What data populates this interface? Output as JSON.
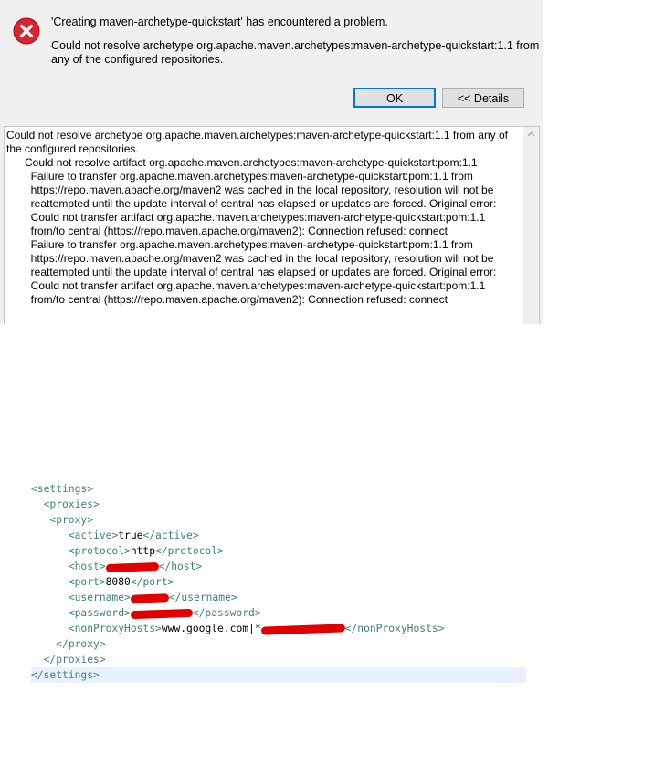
{
  "dialog": {
    "title": "'Creating maven-archetype-quickstart' has encountered a problem.",
    "message": "Could not resolve archetype org.apache.maven.archetypes:maven-archetype-quickstart:1.1 from any of the configured repositories.",
    "ok_label": "OK",
    "details_label": "<< Details",
    "details_text": "Could not resolve archetype org.apache.maven.archetypes:maven-archetype-quickstart:1.1 from any of the configured repositories.\n      Could not resolve artifact org.apache.maven.archetypes:maven-archetype-quickstart:pom:1.1\n        Failure to transfer org.apache.maven.archetypes:maven-archetype-quickstart:pom:1.1 from\n        https://repo.maven.apache.org/maven2 was cached in the local repository, resolution will not be\n        reattempted until the update interval of central has elapsed or updates are forced. Original error:\n        Could not transfer artifact org.apache.maven.archetypes:maven-archetype-quickstart:pom:1.1\n        from/to central (https://repo.maven.apache.org/maven2): Connection refused: connect\n        Failure to transfer org.apache.maven.archetypes:maven-archetype-quickstart:pom:1.1 from\n        https://repo.maven.apache.org/maven2 was cached in the local repository, resolution will not be\n        reattempted until the update interval of central has elapsed or updates are forced. Original error:\n        Could not transfer artifact org.apache.maven.archetypes:maven-archetype-quickstart:pom:1.1\n        from/to central (https://repo.maven.apache.org/maven2): Connection refused: connect"
  },
  "xml": {
    "settings_open": "<settings>",
    "proxies_open": "<proxies>",
    "proxy_open": "<proxy>",
    "active_open": "<active>",
    "active_value": "true",
    "active_close": "</active>",
    "protocol_open": "<protocol>",
    "protocol_value": "http",
    "protocol_close": "</protocol>",
    "host_open": "<host>",
    "host_close": "</host>",
    "port_open": "<port>",
    "port_value": "8080",
    "port_close": "</port>",
    "username_open": "<username>",
    "username_close": "</username>",
    "password_open": "<password>",
    "password_close": "</password>",
    "nonproxy_open": "<nonProxyHosts>",
    "nonproxy_value": "www.google.com|*",
    "nonproxy_close": "</nonProxyHosts>",
    "proxy_close": "</proxy>",
    "proxies_close": "</proxies>",
    "settings_close": "</settings>"
  },
  "colors": {
    "tag": "#3f7f7f",
    "redaction": "#e00000",
    "error_icon": "#d9252f"
  }
}
